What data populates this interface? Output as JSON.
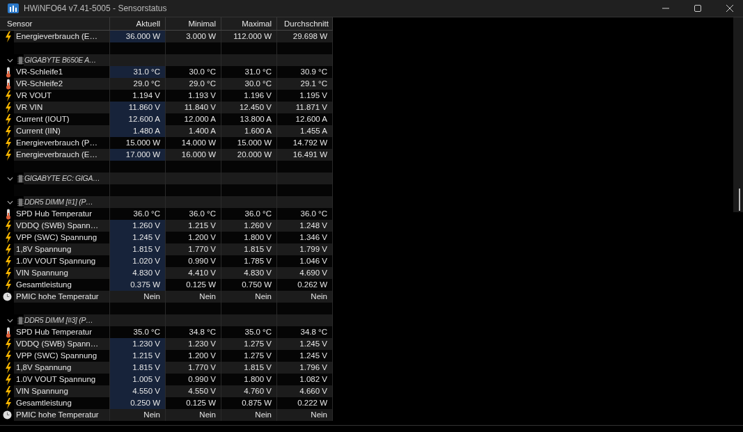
{
  "window": {
    "title": "HWiNFO64 v7.41-5005 - Sensorstatus"
  },
  "columns": [
    "Sensor",
    "Aktuell",
    "Minimal",
    "Maximal",
    "Durchschnitt"
  ],
  "rows": [
    {
      "kind": "power",
      "label": "Energieverbrauch (E…",
      "values": [
        "36.000 W",
        "3.000 W",
        "112.000 W",
        "29.698 W"
      ],
      "highlighted": true
    },
    {
      "kind": "spacer"
    },
    {
      "kind": "group",
      "label": "GIGABYTE B650E A…",
      "expanded": true,
      "children": [
        {
          "kind": "temperature",
          "label": "VR-Schleife1",
          "values": [
            "31.0 °C",
            "30.0 °C",
            "31.0 °C",
            "30.9 °C"
          ],
          "highlighted": true
        },
        {
          "kind": "temperature",
          "label": "VR-Schleife2",
          "values": [
            "29.0 °C",
            "29.0 °C",
            "30.0 °C",
            "29.1 °C"
          ],
          "highlighted": false
        },
        {
          "kind": "power",
          "label": "VR VOUT",
          "values": [
            "1.194 V",
            "1.193 V",
            "1.196 V",
            "1.195 V"
          ],
          "highlighted": false
        },
        {
          "kind": "power",
          "label": "VR VIN",
          "values": [
            "11.860 V",
            "11.840 V",
            "12.450 V",
            "11.871 V"
          ],
          "highlighted": true
        },
        {
          "kind": "power",
          "label": "Current (IOUT)",
          "values": [
            "12.600 A",
            "12.000 A",
            "13.800 A",
            "12.600 A"
          ],
          "highlighted": true
        },
        {
          "kind": "power",
          "label": "Current (IIN)",
          "values": [
            "1.480 A",
            "1.400 A",
            "1.600 A",
            "1.455 A"
          ],
          "highlighted": true
        },
        {
          "kind": "power",
          "label": "Energieverbrauch (P…",
          "values": [
            "15.000 W",
            "14.000 W",
            "15.000 W",
            "14.792 W"
          ],
          "highlighted": false
        },
        {
          "kind": "power",
          "label": "Energieverbrauch (E…",
          "values": [
            "17.000 W",
            "16.000 W",
            "20.000 W",
            "16.491 W"
          ],
          "highlighted": true
        }
      ]
    },
    {
      "kind": "spacer"
    },
    {
      "kind": "group",
      "label": "GIGABYTE EC: GIGA…",
      "expanded": true,
      "children": []
    },
    {
      "kind": "spacer"
    },
    {
      "kind": "group",
      "label": "DDR5 DIMM [#1] (P…",
      "expanded": true,
      "children": [
        {
          "kind": "temperature",
          "label": "SPD Hub Temperatur",
          "values": [
            "36.0 °C",
            "36.0 °C",
            "36.0 °C",
            "36.0 °C"
          ],
          "highlighted": false
        },
        {
          "kind": "power",
          "label": "VDDQ (SWB) Spann…",
          "values": [
            "1.260 V",
            "1.215 V",
            "1.260 V",
            "1.248 V"
          ],
          "highlighted": true
        },
        {
          "kind": "power",
          "label": "VPP (SWC) Spannung",
          "values": [
            "1.245 V",
            "1.200 V",
            "1.800 V",
            "1.346 V"
          ],
          "highlighted": true
        },
        {
          "kind": "power",
          "label": "1,8V Spannung",
          "values": [
            "1.815 V",
            "1.770 V",
            "1.815 V",
            "1.799 V"
          ],
          "highlighted": true
        },
        {
          "kind": "power",
          "label": "1.0V VOUT Spannung",
          "values": [
            "1.020 V",
            "0.990 V",
            "1.785 V",
            "1.046 V"
          ],
          "highlighted": true
        },
        {
          "kind": "power",
          "label": "VIN Spannung",
          "values": [
            "4.830 V",
            "4.410 V",
            "4.830 V",
            "4.690 V"
          ],
          "highlighted": true
        },
        {
          "kind": "power",
          "label": "Gesamtleistung",
          "values": [
            "0.375 W",
            "0.125 W",
            "0.750 W",
            "0.262 W"
          ],
          "highlighted": true
        },
        {
          "kind": "status",
          "label": "PMIC hohe Temperatur",
          "values": [
            "Nein",
            "Nein",
            "Nein",
            "Nein"
          ],
          "highlighted": false
        }
      ]
    },
    {
      "kind": "spacer"
    },
    {
      "kind": "group",
      "label": "DDR5 DIMM [#3] (P…",
      "expanded": true,
      "children": [
        {
          "kind": "temperature",
          "label": "SPD Hub Temperatur",
          "values": [
            "35.0 °C",
            "34.8 °C",
            "35.0 °C",
            "34.8 °C"
          ],
          "highlighted": false
        },
        {
          "kind": "power",
          "label": "VDDQ (SWB) Spann…",
          "values": [
            "1.230 V",
            "1.230 V",
            "1.275 V",
            "1.245 V"
          ],
          "highlighted": true
        },
        {
          "kind": "power",
          "label": "VPP (SWC) Spannung",
          "values": [
            "1.215 V",
            "1.200 V",
            "1.275 V",
            "1.245 V"
          ],
          "highlighted": true
        },
        {
          "kind": "power",
          "label": "1,8V Spannung",
          "values": [
            "1.815 V",
            "1.770 V",
            "1.815 V",
            "1.796 V"
          ],
          "highlighted": true
        },
        {
          "kind": "power",
          "label": "1.0V VOUT Spannung",
          "values": [
            "1.005 V",
            "0.990 V",
            "1.800 V",
            "1.082 V"
          ],
          "highlighted": true
        },
        {
          "kind": "power",
          "label": "VIN Spannung",
          "values": [
            "4.550 V",
            "4.550 V",
            "4.760 V",
            "4.660 V"
          ],
          "highlighted": true
        },
        {
          "kind": "power",
          "label": "Gesamtleistung",
          "values": [
            "0.250 W",
            "0.125 W",
            "0.875 W",
            "0.222 W"
          ],
          "highlighted": true
        },
        {
          "kind": "status",
          "label": "PMIC hohe Temperatur",
          "values": [
            "Nein",
            "Nein",
            "Nein",
            "Nein"
          ],
          "highlighted": false
        }
      ]
    }
  ]
}
